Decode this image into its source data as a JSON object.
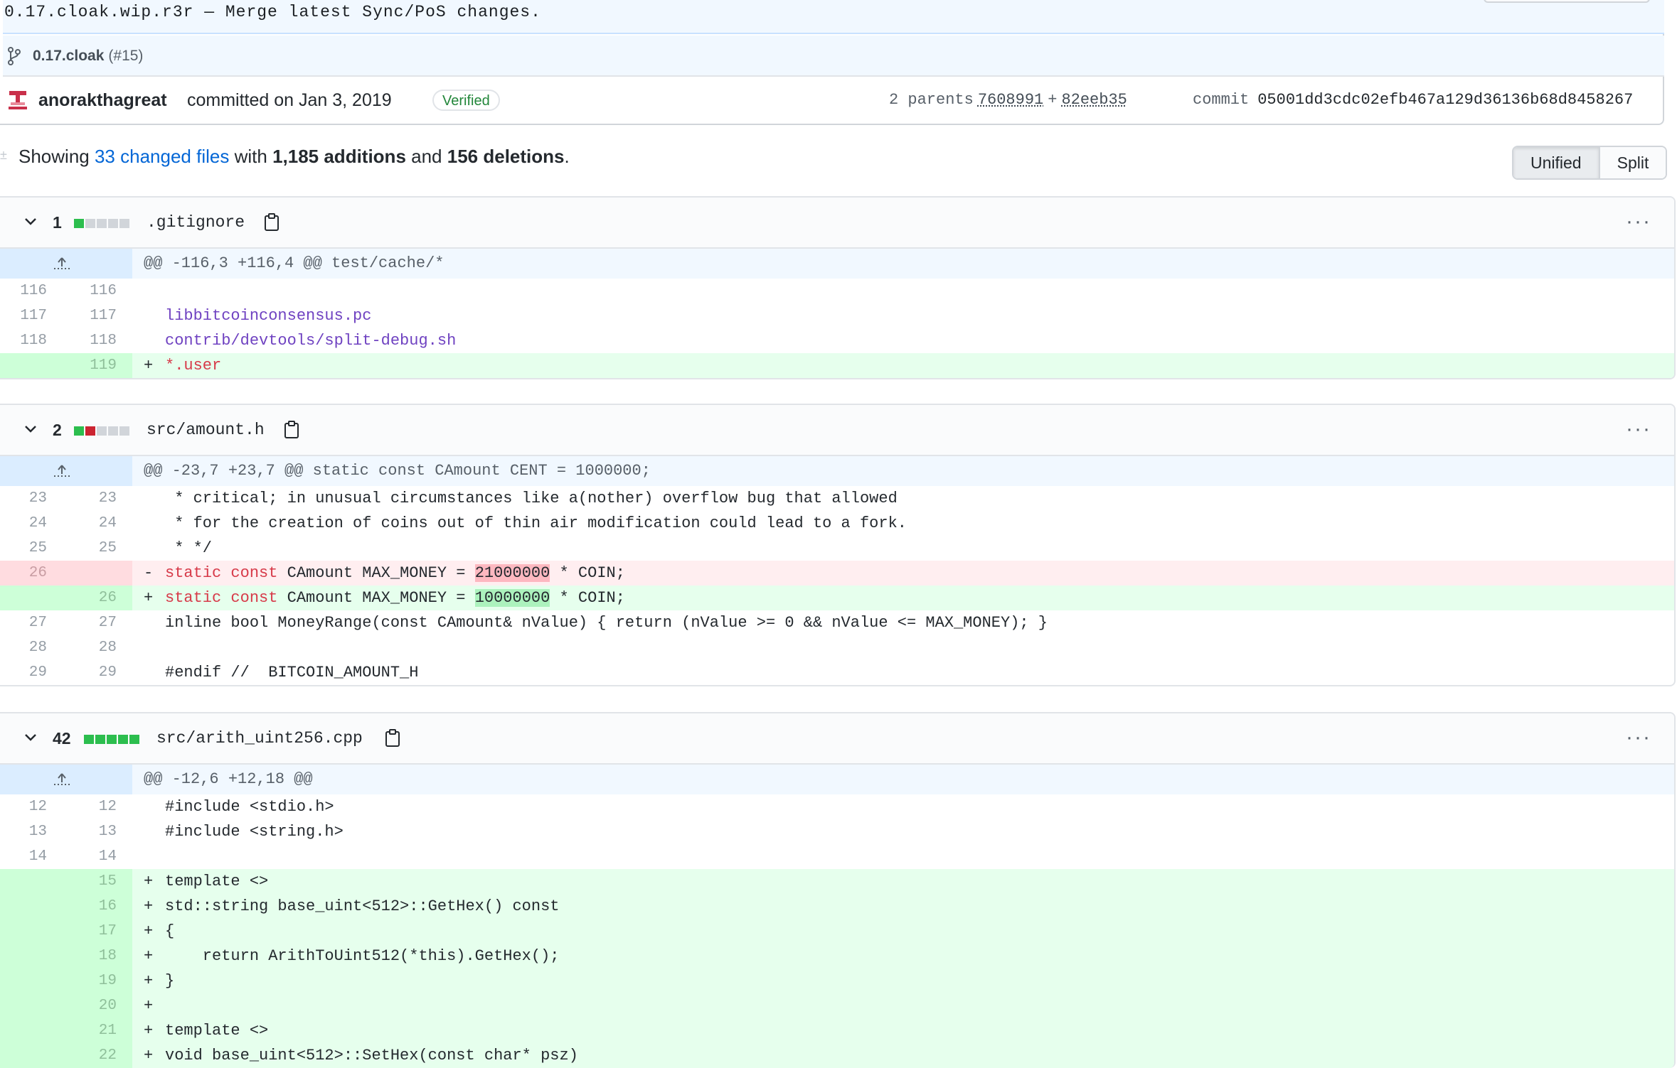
{
  "commit": {
    "title": "0.17.cloak.wip.r3r — Merge latest Sync/PoS changes.",
    "branch": "0.17.cloak",
    "pr": "(#15)",
    "author": "anorakthagreat",
    "action": "committed on Jan 3, 2019",
    "verified": "Verified",
    "parents_label": "2 parents",
    "parent1": "7608991",
    "parent_join": "+",
    "parent2": "82eeb35",
    "commit_label": "commit",
    "sha": "05001dd3cdc02efb467a129d36136b68d8458267"
  },
  "summary": {
    "prefix": "Showing",
    "files_link": "33 changed files",
    "with": "with",
    "additions": "1,185 additions",
    "and": "and",
    "deletions": "156 deletions",
    "end": "."
  },
  "view_toggle": {
    "unified": "Unified",
    "split": "Split"
  },
  "files": [
    {
      "count": "1",
      "name": ".gitignore",
      "hunk": "@@ -116,3 +116,4 @@ test/cache/*",
      "lines": [
        {
          "old": "116",
          "new": "116",
          "t": " ",
          "code": ""
        },
        {
          "old": "117",
          "new": "117",
          "t": " ",
          "code": "libbitcoinconsensus.pc"
        },
        {
          "old": "118",
          "new": "118",
          "t": " ",
          "code": "contrib/devtools/split-debug.sh"
        },
        {
          "old": "",
          "new": "119",
          "t": "+",
          "code": "*.user"
        }
      ]
    },
    {
      "count": "2",
      "name": "src/amount.h",
      "hunk": "@@ -23,7 +23,7 @@ static const CAmount CENT = 1000000;",
      "lines": [
        {
          "old": "23",
          "new": "23",
          "t": " ",
          "code": " * critical; in unusual circumstances like a(nother) overflow bug that allowed"
        },
        {
          "old": "24",
          "new": "24",
          "t": " ",
          "code": " * for the creation of coins out of thin air modification could lead to a fork."
        },
        {
          "old": "25",
          "new": "25",
          "t": " ",
          "code": " * */"
        },
        {
          "old": "26",
          "new": "",
          "t": "-",
          "kw1": "static const",
          "mid": " CAmount MAX_MONEY = ",
          "hl": "21000000",
          "tail": " * COIN;"
        },
        {
          "old": "",
          "new": "26",
          "t": "+",
          "kw1": "static const",
          "mid": " CAmount MAX_MONEY = ",
          "hl": "10000000",
          "tail": " * COIN;"
        },
        {
          "old": "27",
          "new": "27",
          "t": " ",
          "code": "inline bool MoneyRange(const CAmount& nValue) { return (nValue >= 0 && nValue <= MAX_MONEY); }"
        },
        {
          "old": "28",
          "new": "28",
          "t": " ",
          "code": ""
        },
        {
          "old": "29",
          "new": "29",
          "t": " ",
          "code": "#endif //  BITCOIN_AMOUNT_H"
        }
      ]
    },
    {
      "count": "42",
      "name": "src/arith_uint256.cpp",
      "hunk": "@@ -12,6 +12,18 @@",
      "lines": [
        {
          "old": "12",
          "new": "12",
          "t": " ",
          "code": "#include <stdio.h>"
        },
        {
          "old": "13",
          "new": "13",
          "t": " ",
          "code": "#include <string.h>"
        },
        {
          "old": "14",
          "new": "14",
          "t": " ",
          "code": ""
        },
        {
          "old": "",
          "new": "15",
          "t": "+",
          "code": "template <>"
        },
        {
          "old": "",
          "new": "16",
          "t": "+",
          "code": "std::string base_uint<512>::GetHex() const"
        },
        {
          "old": "",
          "new": "17",
          "t": "+",
          "code": "{"
        },
        {
          "old": "",
          "new": "18",
          "t": "+",
          "code": "    return ArithToUint512(*this).GetHex();"
        },
        {
          "old": "",
          "new": "19",
          "t": "+",
          "code": "}"
        },
        {
          "old": "",
          "new": "20",
          "t": "+",
          "code": ""
        },
        {
          "old": "",
          "new": "21",
          "t": "+",
          "code": "template <>"
        },
        {
          "old": "",
          "new": "22",
          "t": "+",
          "code": "void base_uint<512>::SetHex(const char* psz)"
        }
      ]
    }
  ],
  "colors": {
    "link": "#0366d6",
    "added": "#2cbe4e",
    "deleted": "#cb2431",
    "verified": "#22863a"
  },
  "icons": [
    "git-branch-icon",
    "avatar",
    "chevron-down-icon",
    "clipboard-icon",
    "kebab-icon",
    "expand-up-icon"
  ]
}
